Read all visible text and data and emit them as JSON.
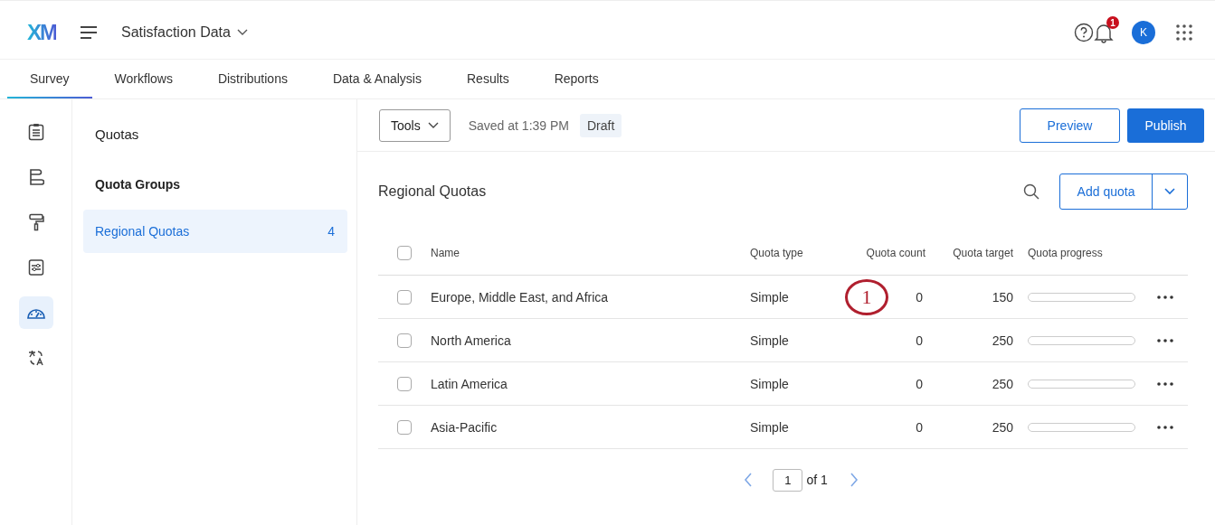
{
  "header": {
    "logo": "XM",
    "project": "Satisfaction Data",
    "notifications": "1",
    "avatar": "K"
  },
  "tabs": [
    {
      "label": "Survey",
      "selected": true
    },
    {
      "label": "Workflows",
      "selected": false
    },
    {
      "label": "Distributions",
      "selected": false
    },
    {
      "label": "Data & Analysis",
      "selected": false
    },
    {
      "label": "Results",
      "selected": false
    },
    {
      "label": "Reports",
      "selected": false
    }
  ],
  "rail": [
    {
      "kind": "survey",
      "selected": false
    },
    {
      "kind": "flow",
      "selected": false
    },
    {
      "kind": "look",
      "selected": false
    },
    {
      "kind": "options",
      "selected": false
    },
    {
      "kind": "quotas",
      "selected": true
    },
    {
      "kind": "translate",
      "selected": false
    }
  ],
  "sidebar": {
    "title": "Quotas",
    "section": "Quota Groups",
    "items": [
      {
        "label": "Regional Quotas",
        "count": "4",
        "selected": true
      }
    ]
  },
  "toolbar": {
    "tools": "Tools",
    "saved": "Saved at 1:39 PM",
    "status": "Draft",
    "preview": "Preview",
    "publish": "Publish"
  },
  "panel": {
    "title": "Regional Quotas",
    "add": "Add quota"
  },
  "table": {
    "columns": [
      "Name",
      "Quota type",
      "Quota count",
      "Quota target",
      "Quota progress"
    ],
    "header_checked": false,
    "rows": [
      {
        "checked": false,
        "name": "Europe, Middle East, and Africa",
        "type": "Simple",
        "count": "0",
        "target": "150",
        "level": 0,
        "callout": "1"
      },
      {
        "checked": false,
        "name": "North America",
        "type": "Simple",
        "count": "0",
        "target": "250",
        "level": 0
      },
      {
        "checked": false,
        "name": "Latin America",
        "type": "Simple",
        "count": "0",
        "target": "250",
        "level": 0
      },
      {
        "checked": false,
        "name": "Asia-Pacific",
        "type": "Simple",
        "count": "0",
        "target": "250",
        "level": 0
      }
    ]
  },
  "pagination": {
    "page": "1",
    "of": "of 1"
  }
}
